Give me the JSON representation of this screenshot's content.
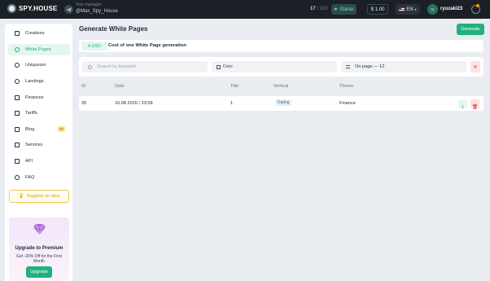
{
  "topbar": {
    "logo_text": "SPY.HOUSE",
    "manager_label": "Your manager:",
    "manager_name": "@Max_Spy_House",
    "counter_value": "17",
    "counter_total": "/ 300",
    "plan": "Starter",
    "balance": "1.00",
    "language": "EN",
    "avatar_initials": "ry",
    "username": "ryuzaki23"
  },
  "sidebar": {
    "items": [
      {
        "label": "Creatives",
        "icon": "cards-icon"
      },
      {
        "label": "White Pages",
        "icon": "globe-icon"
      },
      {
        "label": "Uniquezer",
        "icon": "spark-icon"
      },
      {
        "label": "Landings",
        "icon": "download-icon"
      },
      {
        "label": "Finances",
        "icon": "wallet-icon"
      },
      {
        "label": "Tariffs",
        "icon": "folder-icon"
      },
      {
        "label": "Blog",
        "icon": "pen-icon",
        "badge": "90"
      },
      {
        "label": "Services",
        "icon": "grid-icon"
      },
      {
        "label": "API",
        "icon": "api-icon"
      },
      {
        "label": "FAQ",
        "icon": "question-icon"
      }
    ],
    "suggest": "Suggest an idea",
    "promo": {
      "title": "Upgrade to Premium",
      "text": "Get -20% Off for the First Month",
      "button": "Upgrade"
    }
  },
  "main": {
    "title": "Generate White Pages",
    "generate_button": "Generate",
    "cost_price": "4 USD",
    "cost_text": "Cost of one White Page generation",
    "filters": {
      "search_placeholder": "Search by keyword",
      "date": "Date",
      "per_page": "On page — 12"
    },
    "table": {
      "headers": [
        "ID",
        "Date",
        "Title",
        "Vertical",
        "Theme"
      ],
      "rows": [
        {
          "id": "30",
          "date": "16.08.2026 / 23:58",
          "title": "1",
          "vertical": "Dating",
          "theme": "Finance"
        }
      ]
    }
  },
  "colors": {
    "accent": "#22b07d",
    "topbar": "#1a2025",
    "danger": "#dc2626"
  }
}
